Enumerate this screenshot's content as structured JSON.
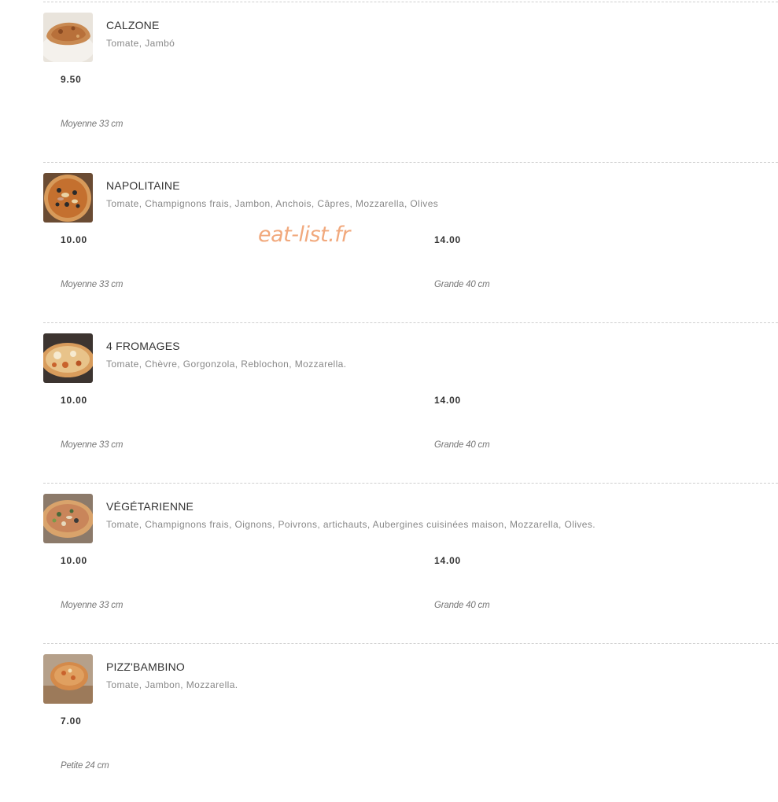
{
  "watermark": "eat-list.fr",
  "items": [
    {
      "name": "CALZONE",
      "description": "Tomate, Jambó",
      "image_icon": "pizza-calzone-photo",
      "prices": [
        {
          "value": "9.50",
          "size": "Moyenne 33 cm"
        }
      ]
    },
    {
      "name": "NAPOLITAINE",
      "description": "Tomate, Champignons frais, Jambon, Anchois, Câpres, Mozzarella, Olives",
      "image_icon": "pizza-napolitaine-photo",
      "prices": [
        {
          "value": "10.00",
          "size": "Moyenne 33 cm"
        },
        {
          "value": "14.00",
          "size": "Grande 40 cm"
        }
      ]
    },
    {
      "name": "4 FROMAGES",
      "description": "Tomate, Chèvre, Gorgonzola, Reblochon, Mozzarella.",
      "image_icon": "pizza-4-fromages-photo",
      "prices": [
        {
          "value": "10.00",
          "size": "Moyenne 33 cm"
        },
        {
          "value": "14.00",
          "size": "Grande 40 cm"
        }
      ]
    },
    {
      "name": "VÉGÉTARIENNE",
      "description": "Tomate, Champignons frais, Oignons, Poivrons, artichauts, Aubergines cuisinées maison, Mozzarella, Olives.",
      "image_icon": "pizza-vegetarienne-photo",
      "prices": [
        {
          "value": "10.00",
          "size": "Moyenne 33 cm"
        },
        {
          "value": "14.00",
          "size": "Grande 40 cm"
        }
      ]
    },
    {
      "name": "PIZZ'BAMBINO",
      "description": "Tomate, Jambon, Mozzarella.",
      "image_icon": "pizza-bambino-photo",
      "prices": [
        {
          "value": "7.00",
          "size": "Petite 24 cm"
        }
      ]
    }
  ]
}
